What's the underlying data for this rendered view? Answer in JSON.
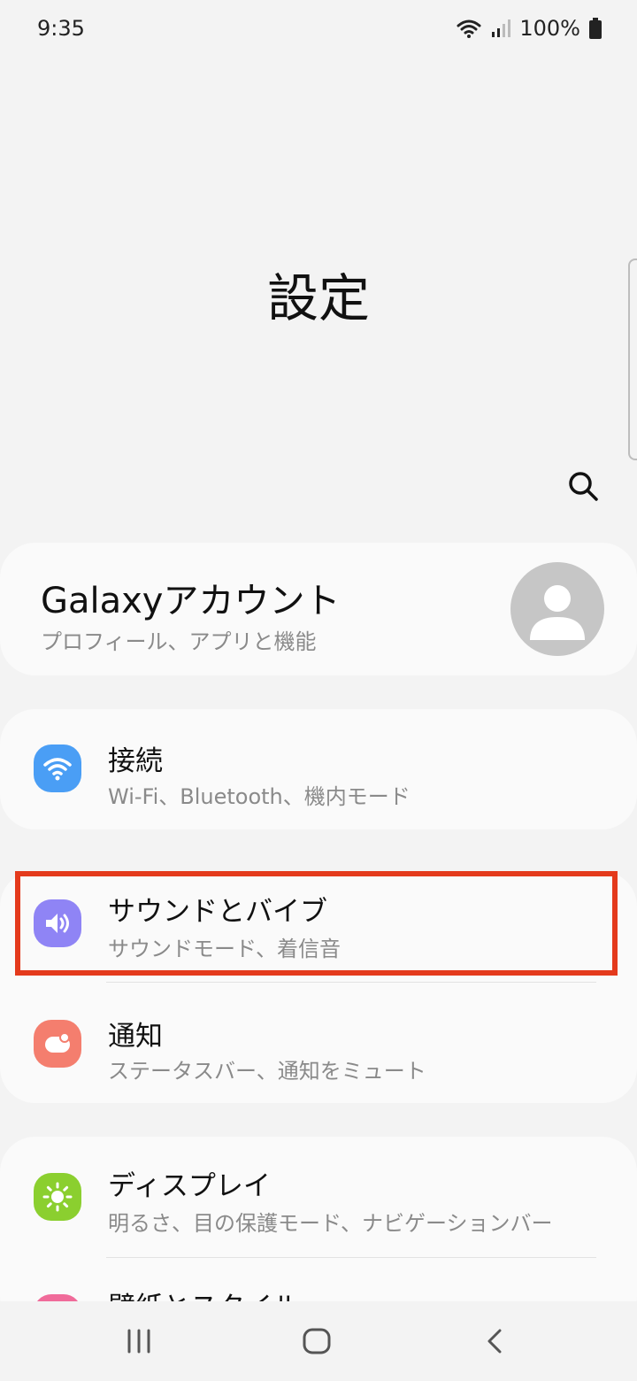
{
  "status_bar": {
    "time": "9:35",
    "battery": "100%"
  },
  "page": {
    "title": "設定"
  },
  "account": {
    "title": "Galaxyアカウント",
    "subtitle": "プロフィール、アプリと機能"
  },
  "items": [
    {
      "title": "接続",
      "subtitle": "Wi-Fi、Bluetooth、機内モード",
      "icon": "wifi-icon",
      "color": "#4a9ef5"
    },
    {
      "title": "サウンドとバイブ",
      "subtitle": "サウンドモード、着信音",
      "icon": "speaker-icon",
      "color": "#8f84f5"
    },
    {
      "title": "通知",
      "subtitle": "ステータスバー、通知をミュート",
      "icon": "notification-icon",
      "color": "#f47e6e"
    },
    {
      "title": "ディスプレイ",
      "subtitle": "明るさ、目の保護モード、ナビゲーションバー",
      "icon": "brightness-icon",
      "color": "#8bcf2f"
    },
    {
      "title": "壁紙とスタイル",
      "subtitle": "",
      "icon": "wallpaper-icon",
      "color": "#f06b9a"
    }
  ],
  "highlight_color": "#e43a1c"
}
